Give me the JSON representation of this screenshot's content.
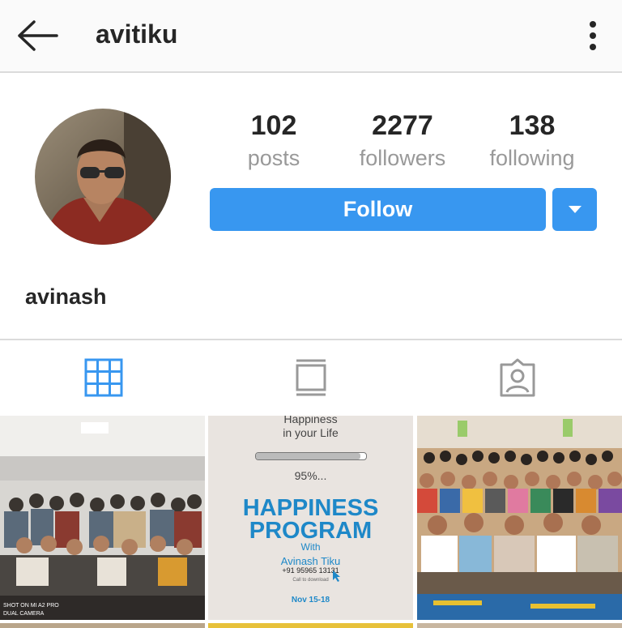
{
  "header": {
    "username": "avitiku",
    "back_icon": "arrow-left-icon",
    "menu_icon": "more-vertical-icon"
  },
  "profile": {
    "stats": [
      {
        "value": "102",
        "label": "posts"
      },
      {
        "value": "2277",
        "label": "followers"
      },
      {
        "value": "138",
        "label": "following"
      }
    ],
    "follow_label": "Follow",
    "display_name": "avinash"
  },
  "tabs": [
    {
      "icon": "grid-icon",
      "active": true
    },
    {
      "icon": "feed-list-icon",
      "active": false
    },
    {
      "icon": "tagged-person-icon",
      "active": false
    }
  ],
  "posts": {
    "poster": {
      "line1": "Happiness",
      "line2": "in your Life",
      "progress_text": "95%...",
      "progress": 0.95,
      "headline1": "HAPPINESS",
      "headline2": "PROGRAM",
      "with": "With",
      "name": "Avinash Tiku",
      "phone": "+91 95965 13131",
      "cta": "Call to download",
      "dates": "Nov 15-18"
    },
    "photo1_caption": "SHOT ON MI A2 PRO\nDUAL CAMERA"
  },
  "colors": {
    "accent": "#3897f0",
    "poster_blue": "#1e88c8"
  }
}
